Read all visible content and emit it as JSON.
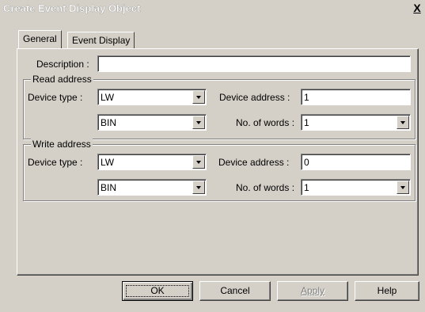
{
  "window": {
    "title": "Create Event Display Object",
    "close_label": "X"
  },
  "tabs": [
    {
      "label": "General",
      "selected": true
    },
    {
      "label": "Event Display",
      "selected": false
    }
  ],
  "general": {
    "description_label": "Description :",
    "description_value": "",
    "read_address": {
      "group_title": "Read address",
      "device_type_label": "Device type :",
      "device_type_value": "LW",
      "format_value": "BIN",
      "device_address_label": "Device address :",
      "device_address_value": "1",
      "no_of_words_label": "No. of words :",
      "no_of_words_value": "1"
    },
    "write_address": {
      "group_title": "Write address",
      "device_type_label": "Device type :",
      "device_type_value": "LW",
      "format_value": "BIN",
      "device_address_label": "Device  address :",
      "device_address_value": "0",
      "no_of_words_label": "No. of words :",
      "no_of_words_value": "1"
    }
  },
  "buttons": {
    "ok": "OK",
    "cancel": "Cancel",
    "apply": "Apply",
    "help": "Help"
  },
  "icons": {
    "dropdown": "chevron-down-icon",
    "close": "close-icon"
  },
  "colors": {
    "dialog_face": "#d4d0c8",
    "field_background": "#ffffff",
    "disabled_text": "#808080"
  }
}
